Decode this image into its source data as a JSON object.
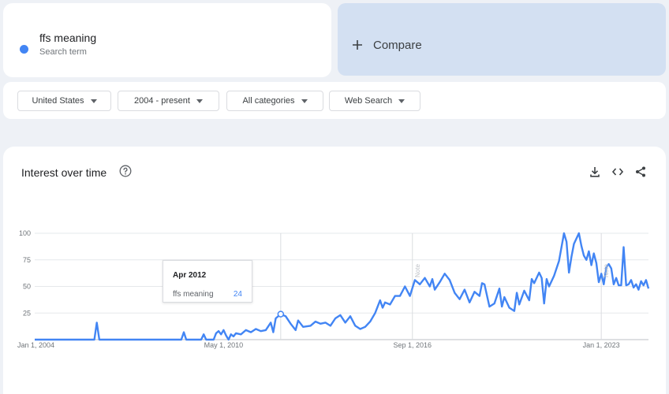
{
  "search_term": {
    "name": "ffs meaning",
    "subtitle": "Search term",
    "color": "#4285f4"
  },
  "compare": {
    "label": "Compare",
    "plus_icon": "plus-icon"
  },
  "filters": {
    "region": "United States",
    "time_range": "2004 - present",
    "category": "All categories",
    "search_type": "Web Search"
  },
  "chart_card": {
    "title": "Interest over time",
    "help_icon": "help-circle-icon",
    "toolbar_icons": [
      "download-icon",
      "embed-code-icon",
      "share-icon"
    ]
  },
  "tooltip": {
    "date": "Apr 2012",
    "term": "ffs meaning",
    "value": "24"
  },
  "chart_data": {
    "type": "line",
    "title": "Interest over time",
    "xlabel": "",
    "ylabel": "",
    "ylim": [
      0,
      100
    ],
    "yticks": [
      "100",
      "75",
      "50",
      "25"
    ],
    "x_tick_labels": [
      "Jan 1, 2004",
      "May 1, 2010",
      "Sep 1, 2016",
      "Jan 1, 2023"
    ],
    "x_range": [
      "2004-01",
      "2024-08"
    ],
    "annotations": [
      "Note",
      "Note"
    ],
    "highlight": {
      "date": "2012-04",
      "value": 24
    },
    "line_color": "#4285f4",
    "grid": true,
    "series": [
      {
        "name": "ffs meaning",
        "points": [
          [
            "2004-01",
            0
          ],
          [
            "2006-01",
            0
          ],
          [
            "2006-02",
            16
          ],
          [
            "2006-03",
            0
          ],
          [
            "2008-12",
            0
          ],
          [
            "2009-01",
            7
          ],
          [
            "2009-02",
            0
          ],
          [
            "2009-08",
            0
          ],
          [
            "2009-09",
            5
          ],
          [
            "2009-10",
            0
          ],
          [
            "2010-01",
            0
          ],
          [
            "2010-02",
            6
          ],
          [
            "2010-03",
            8
          ],
          [
            "2010-04",
            5
          ],
          [
            "2010-05",
            9
          ],
          [
            "2010-06",
            4
          ],
          [
            "2010-07",
            0
          ],
          [
            "2010-08",
            5
          ],
          [
            "2010-09",
            3
          ],
          [
            "2010-10",
            6
          ],
          [
            "2010-12",
            5
          ],
          [
            "2011-02",
            9
          ],
          [
            "2011-04",
            7
          ],
          [
            "2011-06",
            10
          ],
          [
            "2011-08",
            8
          ],
          [
            "2011-10",
            9
          ],
          [
            "2011-12",
            16
          ],
          [
            "2012-01",
            7
          ],
          [
            "2012-02",
            20
          ],
          [
            "2012-04",
            24
          ],
          [
            "2012-06",
            22
          ],
          [
            "2012-08",
            15
          ],
          [
            "2012-10",
            9
          ],
          [
            "2012-11",
            18
          ],
          [
            "2013-01",
            12
          ],
          [
            "2013-04",
            13
          ],
          [
            "2013-06",
            17
          ],
          [
            "2013-08",
            15
          ],
          [
            "2013-10",
            16
          ],
          [
            "2013-12",
            13
          ],
          [
            "2014-02",
            20
          ],
          [
            "2014-04",
            23
          ],
          [
            "2014-06",
            16
          ],
          [
            "2014-08",
            22
          ],
          [
            "2014-10",
            13
          ],
          [
            "2014-12",
            10
          ],
          [
            "2015-02",
            12
          ],
          [
            "2015-04",
            17
          ],
          [
            "2015-06",
            25
          ],
          [
            "2015-08",
            37
          ],
          [
            "2015-09",
            30
          ],
          [
            "2015-10",
            35
          ],
          [
            "2015-12",
            33
          ],
          [
            "2016-02",
            41
          ],
          [
            "2016-04",
            41
          ],
          [
            "2016-06",
            50
          ],
          [
            "2016-08",
            41
          ],
          [
            "2016-10",
            56
          ],
          [
            "2016-12",
            52
          ],
          [
            "2017-02",
            58
          ],
          [
            "2017-04",
            50
          ],
          [
            "2017-05",
            57
          ],
          [
            "2017-06",
            47
          ],
          [
            "2017-08",
            54
          ],
          [
            "2017-10",
            62
          ],
          [
            "2017-12",
            56
          ],
          [
            "2018-02",
            44
          ],
          [
            "2018-04",
            38
          ],
          [
            "2018-06",
            47
          ],
          [
            "2018-08",
            35
          ],
          [
            "2018-10",
            45
          ],
          [
            "2018-12",
            41
          ],
          [
            "2019-01",
            53
          ],
          [
            "2019-02",
            52
          ],
          [
            "2019-04",
            31
          ],
          [
            "2019-06",
            34
          ],
          [
            "2019-08",
            48
          ],
          [
            "2019-09",
            31
          ],
          [
            "2019-10",
            40
          ],
          [
            "2019-12",
            30
          ],
          [
            "2020-02",
            27
          ],
          [
            "2020-03",
            44
          ],
          [
            "2020-04",
            33
          ],
          [
            "2020-06",
            46
          ],
          [
            "2020-08",
            37
          ],
          [
            "2020-09",
            57
          ],
          [
            "2020-10",
            53
          ],
          [
            "2020-12",
            63
          ],
          [
            "2021-01",
            58
          ],
          [
            "2021-02",
            34
          ],
          [
            "2021-03",
            57
          ],
          [
            "2021-04",
            50
          ],
          [
            "2021-06",
            60
          ],
          [
            "2021-08",
            74
          ],
          [
            "2021-10",
            100
          ],
          [
            "2021-11",
            92
          ],
          [
            "2021-12",
            63
          ],
          [
            "2022-01",
            78
          ],
          [
            "2022-02",
            90
          ],
          [
            "2022-04",
            100
          ],
          [
            "2022-05",
            88
          ],
          [
            "2022-06",
            79
          ],
          [
            "2022-07",
            75
          ],
          [
            "2022-08",
            83
          ],
          [
            "2022-09",
            70
          ],
          [
            "2022-10",
            81
          ],
          [
            "2022-11",
            72
          ],
          [
            "2022-12",
            54
          ],
          [
            "2023-01",
            62
          ],
          [
            "2023-02",
            52
          ],
          [
            "2023-03",
            68
          ],
          [
            "2023-04",
            71
          ],
          [
            "2023-05",
            67
          ],
          [
            "2023-06",
            52
          ],
          [
            "2023-07",
            58
          ],
          [
            "2023-08",
            51
          ],
          [
            "2023-09",
            51
          ],
          [
            "2023-10",
            87
          ],
          [
            "2023-11",
            51
          ],
          [
            "2023-12",
            52
          ],
          [
            "2024-01",
            56
          ],
          [
            "2024-02",
            49
          ],
          [
            "2024-03",
            52
          ],
          [
            "2024-04",
            47
          ],
          [
            "2024-05",
            55
          ],
          [
            "2024-06",
            51
          ],
          [
            "2024-07",
            56
          ],
          [
            "2024-08",
            48
          ]
        ]
      }
    ]
  }
}
